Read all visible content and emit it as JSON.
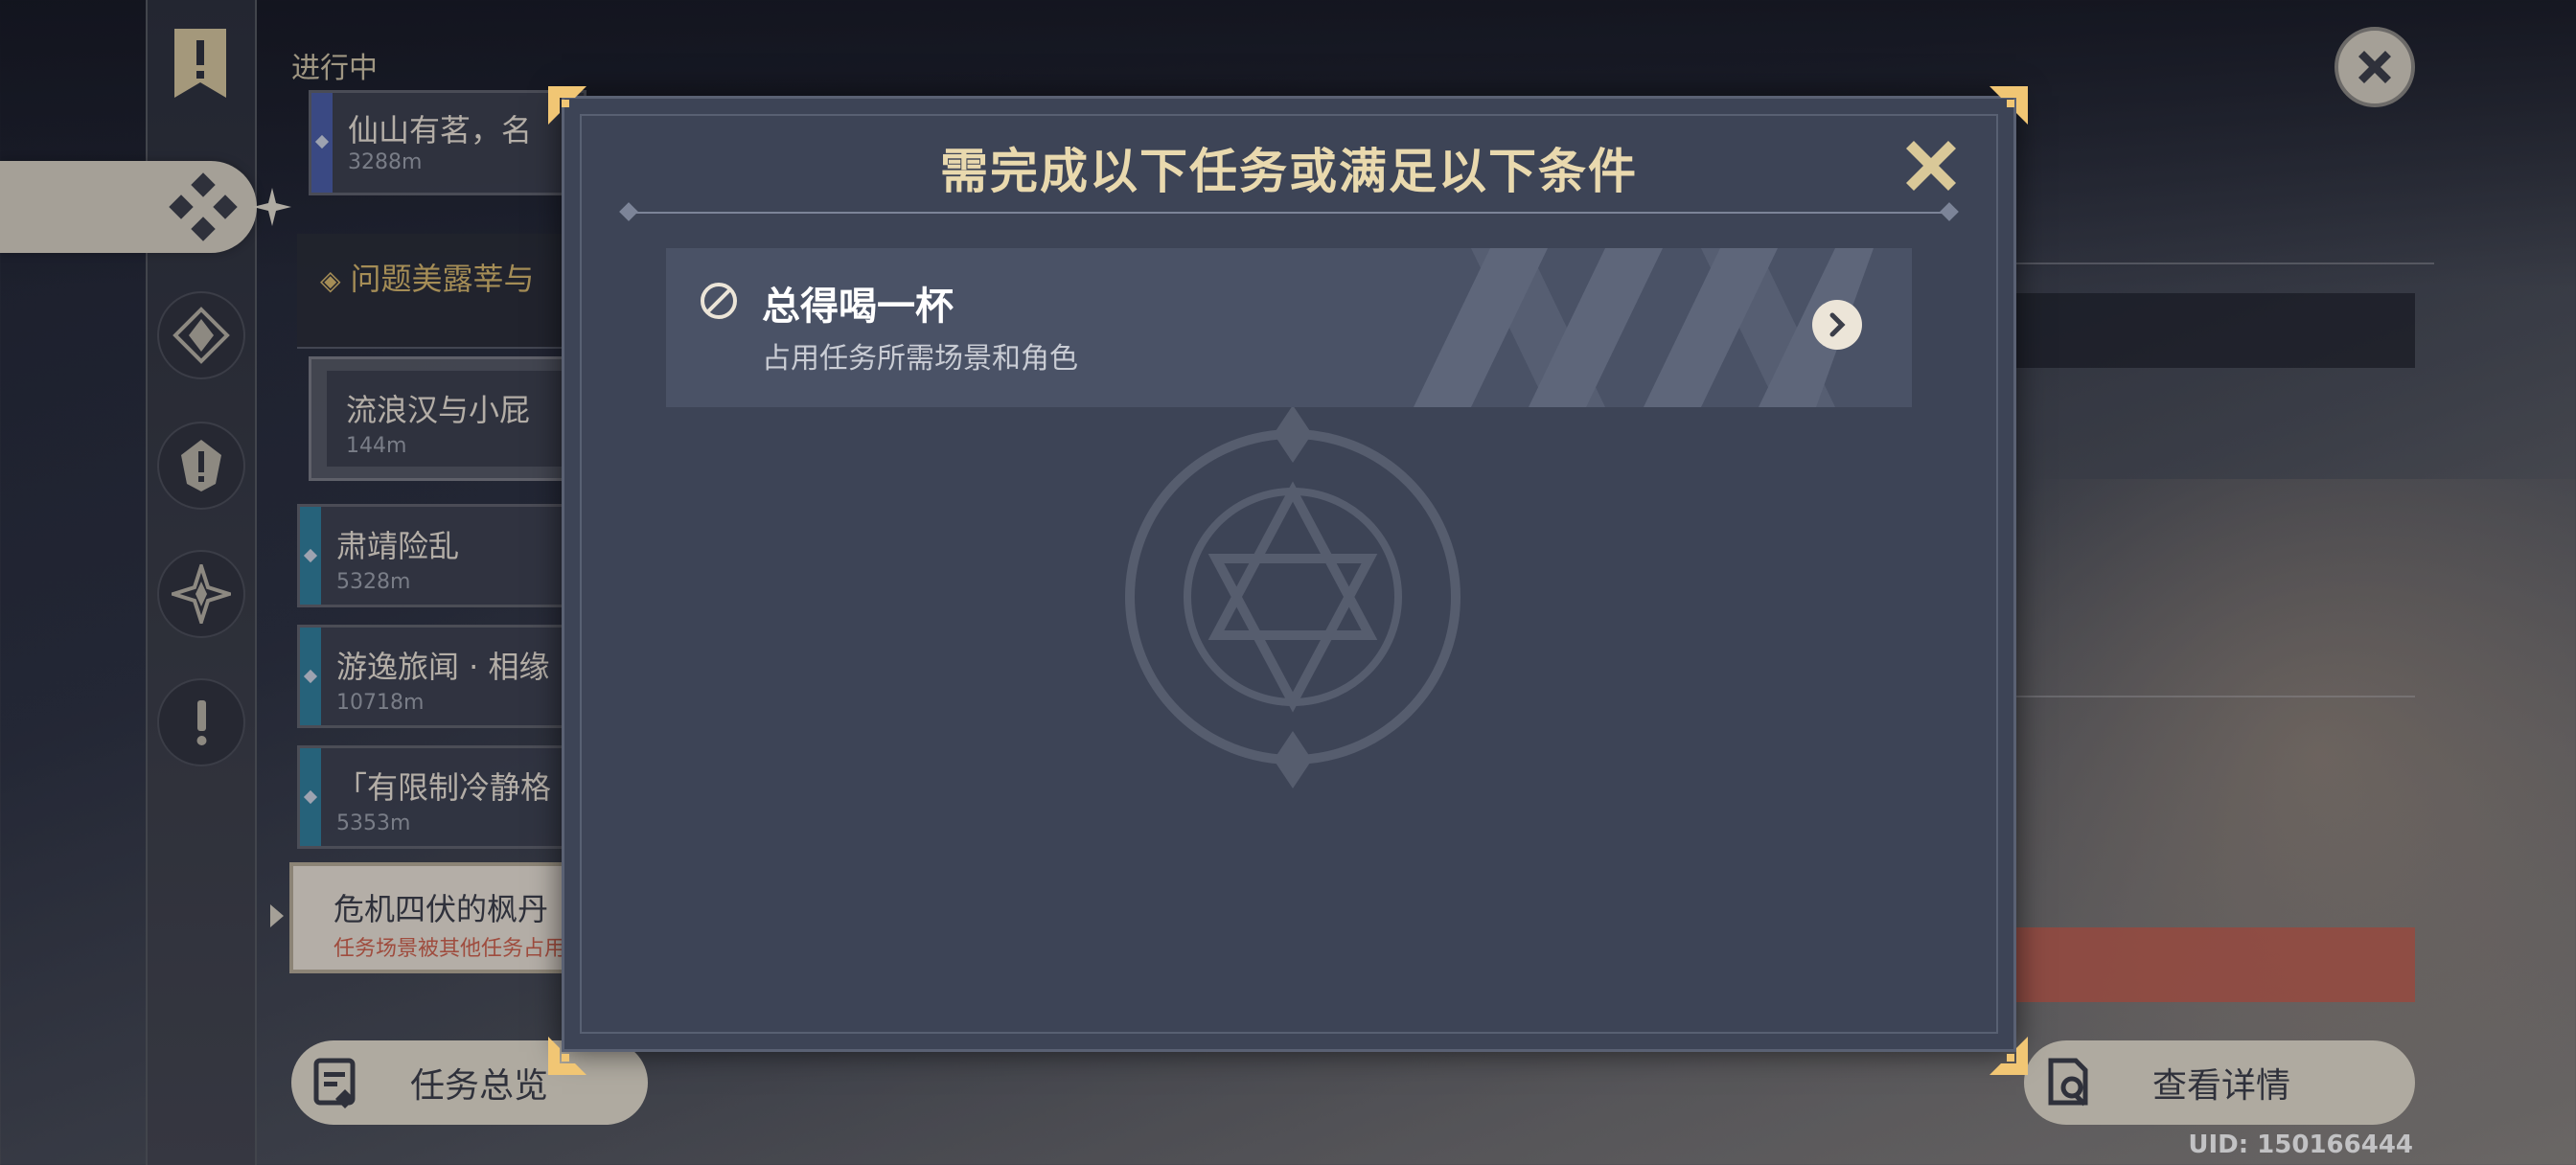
{
  "quest_list": {
    "header": "进行中",
    "items": [
      {
        "title": "仙山有茗，名",
        "distance": "3288m",
        "color": "#4a5ea8"
      },
      {
        "title": "肃靖险乱",
        "distance": "5328m",
        "color": "#2f7f9c"
      },
      {
        "title": "游逸旅闻 · 相缘",
        "distance": "10718m",
        "color": "#2f7f9c"
      },
      {
        "title": "「有限制冷静格",
        "distance": "5353m",
        "color": "#2f7f9c"
      }
    ],
    "group": {
      "title": "问题美露莘与"
    },
    "sub_item": {
      "title": "流浪汉与小屁",
      "distance": "144m"
    },
    "selected": {
      "title": "危机四伏的枫丹",
      "subtitle": "任务场景被其他任务占用"
    }
  },
  "buttons": {
    "overview": "任务总览",
    "details": "查看详情"
  },
  "uid": "UID: 150166444",
  "modal": {
    "title": "需完成以下任务或满足以下条件",
    "condition": {
      "title": "总得喝一杯",
      "description": "占用任务所需场景和角色"
    }
  },
  "icons": {
    "rail": [
      "banner-icon",
      "quest-all-icon",
      "archon-quest-icon",
      "story-quest-icon",
      "world-quest-icon",
      "commission-icon"
    ],
    "modal": [
      "close-icon",
      "blocked-icon",
      "chevron-right-icon"
    ]
  },
  "colors": {
    "accent_gold": "#e9d9ae",
    "modal_bg": "#3d4456",
    "button_bg": "#e6dfcf",
    "warning_red": "#d0624d"
  }
}
